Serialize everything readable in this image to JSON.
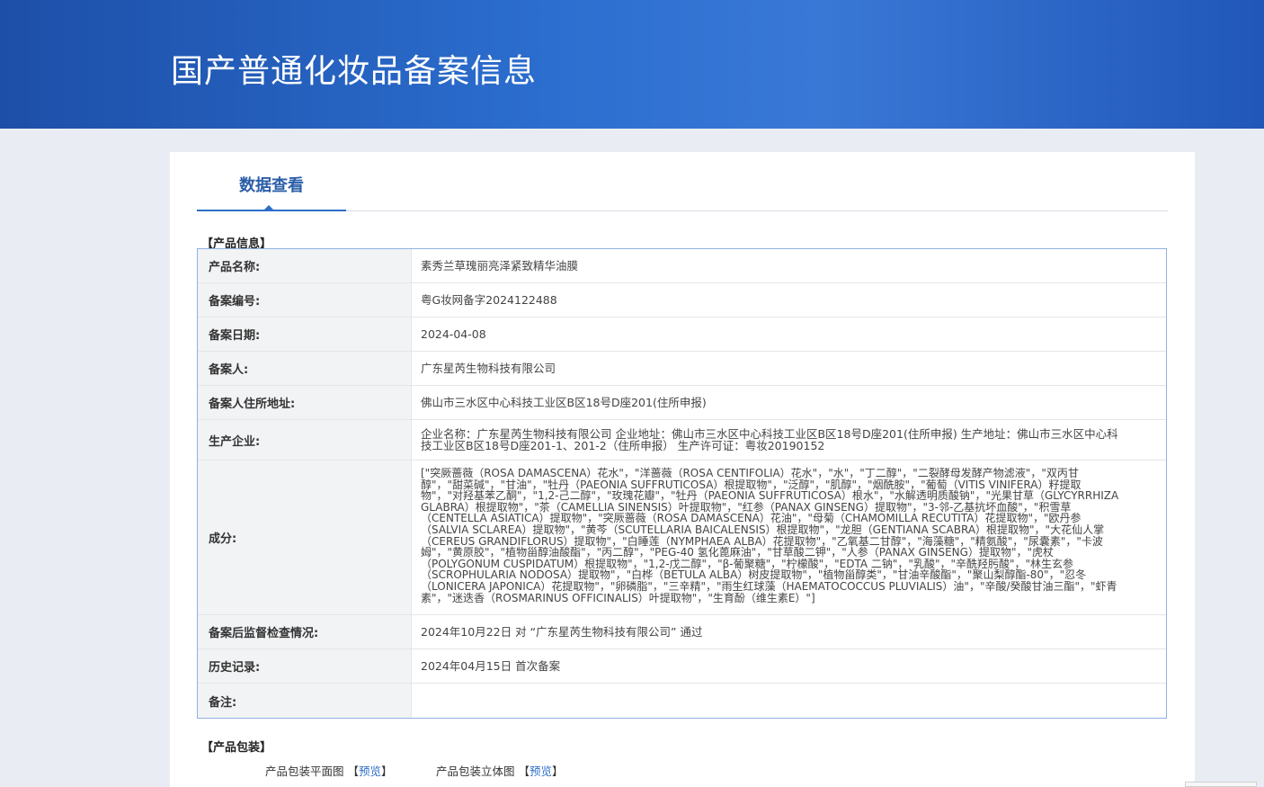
{
  "header": {
    "title": "国产普通化妆品备案信息"
  },
  "tabs": [
    {
      "label": "数据查看",
      "active": true
    }
  ],
  "product_info": {
    "section_title": "【产品信息】",
    "rows": [
      {
        "key": "产品名称:",
        "value": "素秀兰草瑰丽亮泽紧致精华油膜"
      },
      {
        "key": "备案编号:",
        "value": "粤G妆网备字2024122488"
      },
      {
        "key": "备案日期:",
        "value": "2024-04-08"
      },
      {
        "key": "备案人:",
        "value": "广东星芮生物科技有限公司"
      },
      {
        "key": "备案人住所地址:",
        "value": "佛山市三水区中心科技工业区B区18号D座201(住所申报)"
      },
      {
        "key": "生产企业:",
        "value": "企业名称：广东星芮生物科技有限公司 企业地址：佛山市三水区中心科技工业区B区18号D座201(住所申报) 生产地址：佛山市三水区中心科技工业区B区18号D座201-1、201-2（住所申报） 生产许可证：粤妆20190152"
      },
      {
        "key": "成分:",
        "value": "[\"突厥蔷薇（ROSA DAMASCENA）花水\"，\"洋蔷薇（ROSA CENTIFOLIA）花水\"，\"水\"，\"丁二醇\"，\"二裂酵母发酵产物滤液\"，\"双丙甘醇\"，\"甜菜碱\"，\"甘油\"，\"牡丹（PAEONIA SUFFRUTICOSA）根提取物\"，\"泛醇\"，\"肌醇\"，\"烟酰胺\"，\"葡萄（VITIS VINIFERA）籽提取物\"，\"对羟基苯乙酮\"，\"1,2-己二醇\"，\"玫瑰花瓣\"，\"牡丹（PAEONIA SUFFRUTICOSA）根水\"，\"水解透明质酸钠\"，\"光果甘草（GLYCYRRHIZA GLABRA）根提取物\"，\"茶（CAMELLIA SINENSIS）叶提取物\"，\"红参（PANAX GINSENG）提取物\"，\"3-邻-乙基抗坏血酸\"，\"积雪草（CENTELLA ASIATICA）提取物\"，\"突厥蔷薇（ROSA DAMASCENA）花油\"，\"母菊（CHAMOMILLA RECUTITA）花提取物\"，\"欧丹参（SALVIA SCLAREA）提取物\"，\"黄芩（SCUTELLARIA BAICALENSIS）根提取物\"，\"龙胆（GENTIANA SCABRA）根提取物\"，\"大花仙人掌（CEREUS GRANDIFLORUS）提取物\"，\"白睡莲（NYMPHAEA ALBA）花提取物\"，\"乙氧基二甘醇\"，\"海藻糖\"，\"精氨酸\"，\"尿囊素\"，\"卡波姆\"，\"黄原胶\"，\"植物甾醇油酸酯\"，\"丙二醇\"，\"PEG-40 氢化蓖麻油\"，\"甘草酸二钾\"，\"人参（PANAX GINSENG）提取物\"，\"虎杖（POLYGONUM CUSPIDATUM）根提取物\"，\"1,2-戊二醇\"，\"β-葡聚糖\"，\"柠檬酸\"，\"EDTA 二钠\"，\"乳酸\"，\"辛酰羟肟酸\"，\"林生玄参（SCROPHULARIA NODOSA）提取物\"，\"白桦（BETULA ALBA）树皮提取物\"，\"植物甾醇类\"，\"甘油辛酸酯\"，\"聚山梨醇酯-80\"，\"忍冬（LONICERA JAPONICA）花提取物\"，\"卵磷脂\"，\"三辛精\"，\"雨生红球藻（HAEMATOCOCCUS PLUVIALIS）油\"，\"辛酸/癸酸甘油三酯\"，\"虾青素\"，\"迷迭香（ROSMARINUS OFFICINALIS）叶提取物\"，\"生育酚（维生素E）\"]"
      },
      {
        "key": "备案后监督检查情况:",
        "value": "2024年10月22日 对 “广东星芮生物科技有限公司” 通过"
      },
      {
        "key": "历史记录:",
        "value": "2024年04月15日 首次备案"
      },
      {
        "key": "备注:",
        "value": ""
      }
    ]
  },
  "packaging": {
    "section_title": "【产品包装】",
    "flat_label": "产品包装平面图",
    "solid_label": "产品包装立体图",
    "bracket_open": "【",
    "bracket_close": "】",
    "preview_label": "预览"
  }
}
